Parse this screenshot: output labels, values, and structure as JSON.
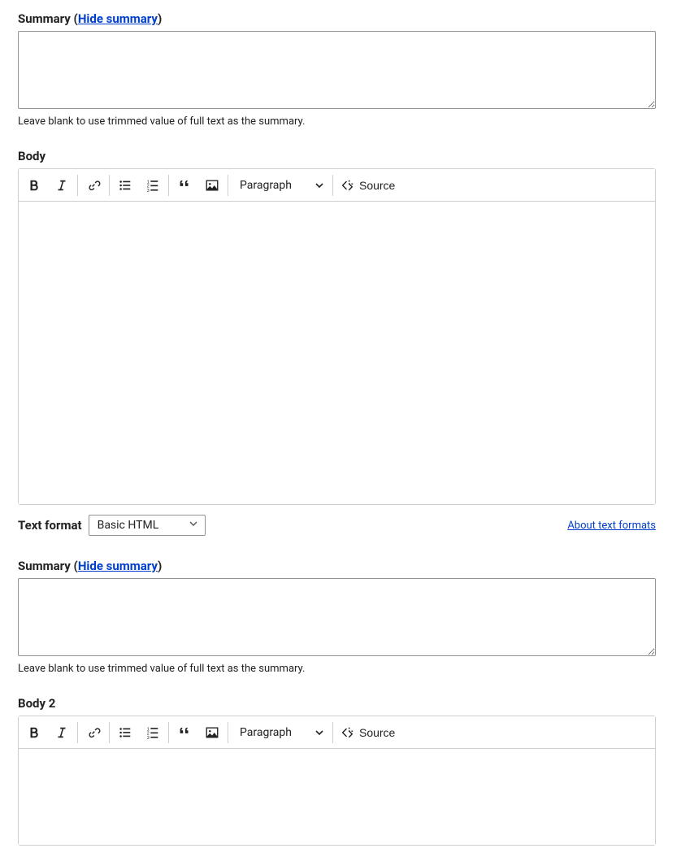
{
  "summary1": {
    "label_prefix": "Summary",
    "paren_open": " (",
    "toggle_link": "Hide summary",
    "paren_close": ")",
    "value": "",
    "help": "Leave blank to use trimmed value of full text as the summary."
  },
  "body1": {
    "label": "Body",
    "toolbar": {
      "heading_label": "Paragraph",
      "source_label": "Source"
    }
  },
  "text_format": {
    "label": "Text format",
    "selected": "Basic HTML",
    "about_link": "About text formats"
  },
  "summary2": {
    "label_prefix": "Summary",
    "paren_open": " (",
    "toggle_link": "Hide summary",
    "paren_close": ")",
    "value": "",
    "help": "Leave blank to use trimmed value of full text as the summary."
  },
  "body2": {
    "label": "Body 2",
    "toolbar": {
      "heading_label": "Paragraph",
      "source_label": "Source"
    }
  }
}
